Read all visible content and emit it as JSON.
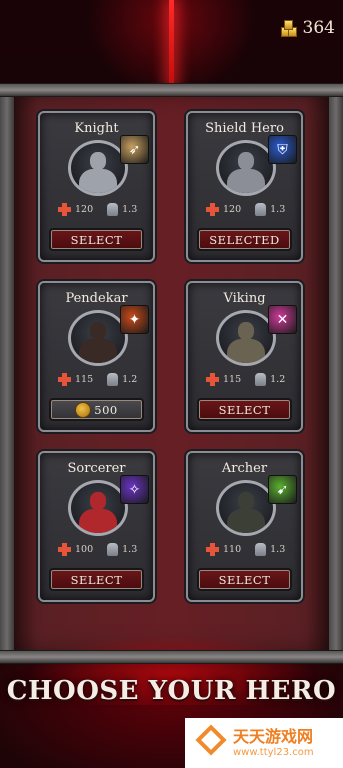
{
  "header": {
    "gold_value": "364",
    "gold_icon": "gold-bars-icon"
  },
  "heroes": [
    {
      "name": "Knight",
      "hp": "120",
      "attack": "1.3",
      "button": "SELECT",
      "button_type": "select",
      "skill_icon": "spear-thrust-icon",
      "skill_color": "#c8a060",
      "accent": "#9ea2aa"
    },
    {
      "name": "Shield Hero",
      "hp": "120",
      "attack": "1.3",
      "button": "SELECTED",
      "button_type": "select",
      "skill_icon": "blue-shield-icon",
      "skill_color": "#2a5bd0",
      "accent": "#8b8e96"
    },
    {
      "name": "Pendekar",
      "hp": "115",
      "attack": "1.2",
      "button": "500",
      "button_type": "price",
      "skill_icon": "fire-slash-icon",
      "skill_color": "#c94a1a",
      "accent": "#3a2a26"
    },
    {
      "name": "Viking",
      "hp": "115",
      "attack": "1.2",
      "button": "SELECT",
      "button_type": "select",
      "skill_icon": "pink-axe-icon",
      "skill_color": "#d03a9a",
      "accent": "#6b6352"
    },
    {
      "name": "Sorcerer",
      "hp": "100",
      "attack": "1.3",
      "button": "SELECT",
      "button_type": "select",
      "skill_icon": "magic-staff-icon",
      "skill_color": "#6a34c4",
      "accent": "#b0282c"
    },
    {
      "name": "Archer",
      "hp": "110",
      "attack": "1.3",
      "button": "SELECT",
      "button_type": "select",
      "skill_icon": "green-bow-icon",
      "skill_color": "#5ab030",
      "accent": "#3b3f36"
    }
  ],
  "footer": {
    "title": "CHOOSE YOUR HERO"
  },
  "watermark": {
    "name": "天天游戏网",
    "url": "www.ttyl23.com"
  }
}
